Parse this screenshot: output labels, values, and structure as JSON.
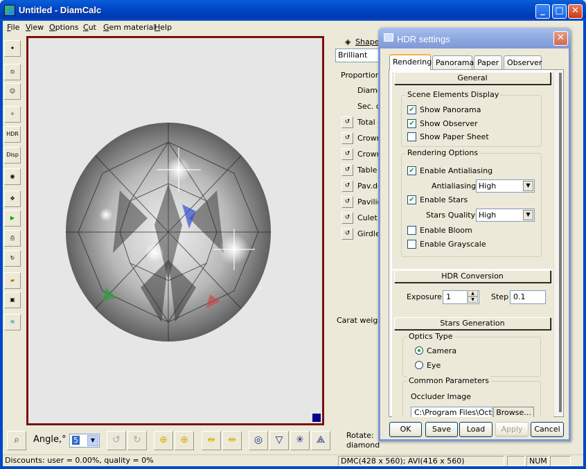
{
  "window": {
    "title": "Untitled - DiamCalc"
  },
  "menu": [
    {
      "label": "File",
      "u": "F",
      "rest": "ile"
    },
    {
      "label": "View",
      "u": "V",
      "rest": "iew"
    },
    {
      "label": "Options",
      "u": "O",
      "rest": "ptions"
    },
    {
      "label": "Cut",
      "u": "C",
      "rest": "ut"
    },
    {
      "label": "Gem material",
      "u": "G",
      "rest": "em material"
    },
    {
      "label": "Help",
      "u": "H",
      "rest": "elp"
    }
  ],
  "left_toolbar": {
    "hdr_label": "HDR",
    "disp_label": "Disp"
  },
  "right_panel": {
    "shape_label": "Shape",
    "shape_value": "Brilliant",
    "proportions_label": "Proportions",
    "diameter": "Diame",
    "sec": "Sec. d",
    "rows": [
      "Total d",
      "Crown",
      "Crown",
      "Table",
      "Pav.de",
      "Pavilio",
      "Culet",
      "Girdle"
    ],
    "carat_weight": "Carat weight",
    "rotate": "Rotate:",
    "diamond": "diamond"
  },
  "bottom_toolbar": {
    "angle_label": "Angle,°",
    "angle_value": "5"
  },
  "statusbar": {
    "discounts": "Discounts: user = 0.00%, quality = 0%",
    "dmc": "DMC(428 x 560); AVI(416 x 560)",
    "num": "NUM"
  },
  "dialog": {
    "title": "HDR settings",
    "tabs": [
      "Rendering",
      "Panorama",
      "Paper",
      "Observer"
    ],
    "active_tab": "Rendering",
    "general": {
      "header": "General",
      "scene_group": "Scene Elements Display",
      "show_panorama": "Show Panorama",
      "show_observer": "Show Observer",
      "show_paper": "Show Paper Sheet",
      "rendering_group": "Rendering Options",
      "enable_aa": "Enable Antialiasing",
      "aa_label": "Antialiasing",
      "aa_value": "High",
      "enable_stars": "Enable Stars",
      "stars_quality_label": "Stars Quality",
      "stars_quality_value": "High",
      "enable_bloom": "Enable Bloom",
      "enable_grayscale": "Enable Grayscale"
    },
    "hdr_conversion": {
      "header": "HDR Conversion",
      "exposure_label": "Exposure",
      "exposure_value": "1",
      "step_label": "Step",
      "step_value": "0.1"
    },
    "stars_generation": {
      "header": "Stars Generation",
      "optics_group": "Optics Type",
      "camera": "Camera",
      "eye": "Eye",
      "common_group": "Common Parameters",
      "occluder_label": "Occluder Image",
      "occluder_path": "C:\\Program Files\\OctoN",
      "browse": "Browse..."
    },
    "buttons": {
      "ok": "OK",
      "save": "Save",
      "load": "Load",
      "apply": "Apply",
      "cancel": "Cancel"
    }
  }
}
